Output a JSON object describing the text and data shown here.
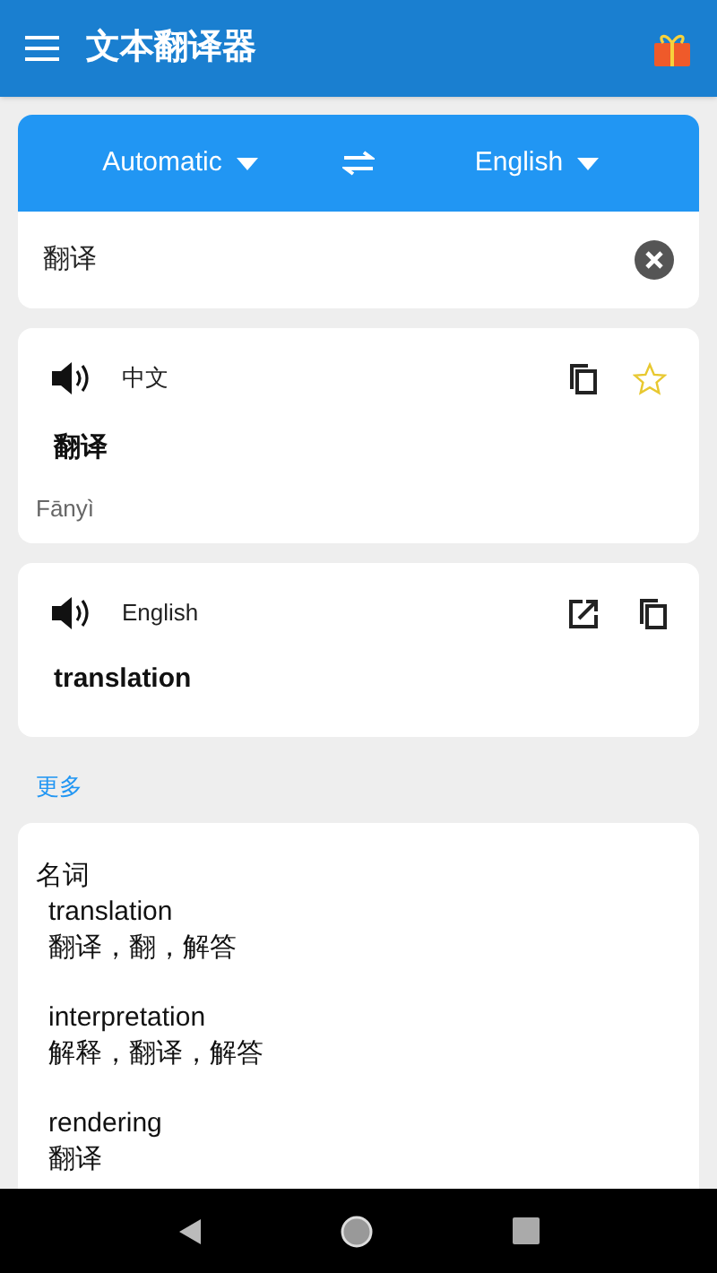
{
  "app_bar": {
    "title": "文本翻译器"
  },
  "languages": {
    "source": "Automatic",
    "target": "English"
  },
  "input": {
    "value": "翻译"
  },
  "source_card": {
    "language": "中文",
    "text": "翻译",
    "romanization": "Fānyì",
    "favorite": false
  },
  "target_card": {
    "language": "English",
    "text": "translation"
  },
  "more_link": "更多",
  "dictionary": {
    "part_of_speech": "名词",
    "entries": [
      {
        "word": "translation",
        "meanings": "翻译，翻，解答"
      },
      {
        "word": "interpretation",
        "meanings": "解释，翻译，解答"
      },
      {
        "word": "rendering",
        "meanings": "翻译"
      }
    ]
  }
}
